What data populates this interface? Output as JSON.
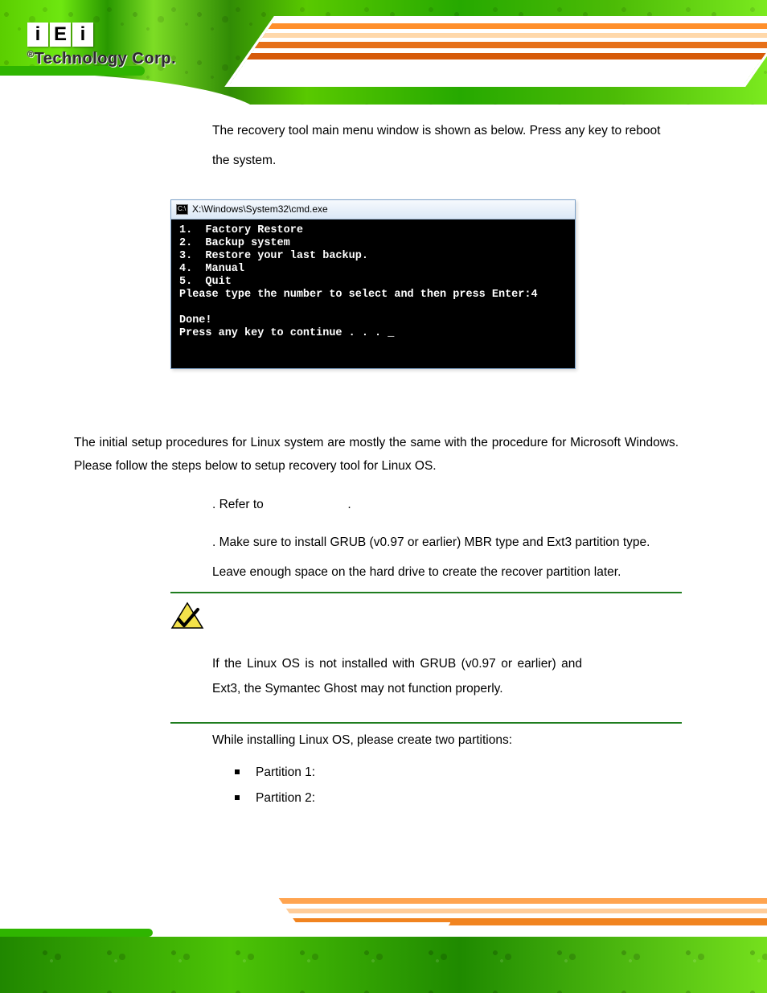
{
  "header": {
    "logo_letters": [
      "i",
      "E",
      "i"
    ],
    "logo_mark": "®",
    "logo_text": "Technology Corp."
  },
  "body": {
    "intro": "The recovery tool main menu window is shown as below. Press any key to reboot the system.",
    "cmd_title": "X:\\Windows\\System32\\cmd.exe",
    "cmd_lines": "1.  Factory Restore\n2.  Backup system\n3.  Restore your last backup.\n4.  Manual\n5.  Quit\nPlease type the number to select and then press Enter:4\n\nDone!\nPress any key to continue . . . _",
    "section": "The initial setup procedures for Linux system are mostly the same with the procedure for Microsoft Windows. Please follow the steps below to setup recovery tool for Linux OS.",
    "step1_mid": ". Refer to",
    "step1_end": ".",
    "step2": ". Make sure to install GRUB (v0.97 or earlier) MBR type and Ext3 partition type. Leave enough space on the hard drive to create the recover partition later.",
    "note": "If the Linux OS is not installed with GRUB (v0.97 or earlier) and Ext3, the Symantec Ghost may not function properly.",
    "subtext": "While installing Linux OS, please create two partitions:",
    "bullets": [
      "Partition 1:",
      "Partition 2:"
    ]
  }
}
